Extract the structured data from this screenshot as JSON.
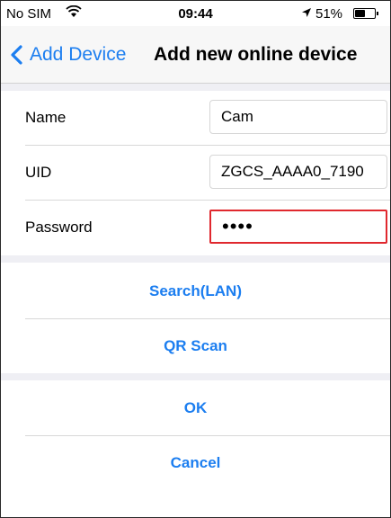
{
  "status_bar": {
    "carrier": "No SIM",
    "time": "09:44",
    "battery_text": "51%",
    "battery_level": 0.51
  },
  "nav": {
    "back_label": "Add Device",
    "title": "Add new online device"
  },
  "form": {
    "name_label": "Name",
    "name_value": "Cam",
    "uid_label": "UID",
    "uid_value": "ZGCS_AAAA0_7190",
    "password_label": "Password",
    "password_value": "••••"
  },
  "actions": {
    "search_lan": "Search(LAN)",
    "qr_scan": "QR Scan",
    "ok": "OK",
    "cancel": "Cancel"
  },
  "colors": {
    "accent": "#1c7ef0",
    "highlight": "#e0282e",
    "separator_bg": "#efeff4"
  }
}
